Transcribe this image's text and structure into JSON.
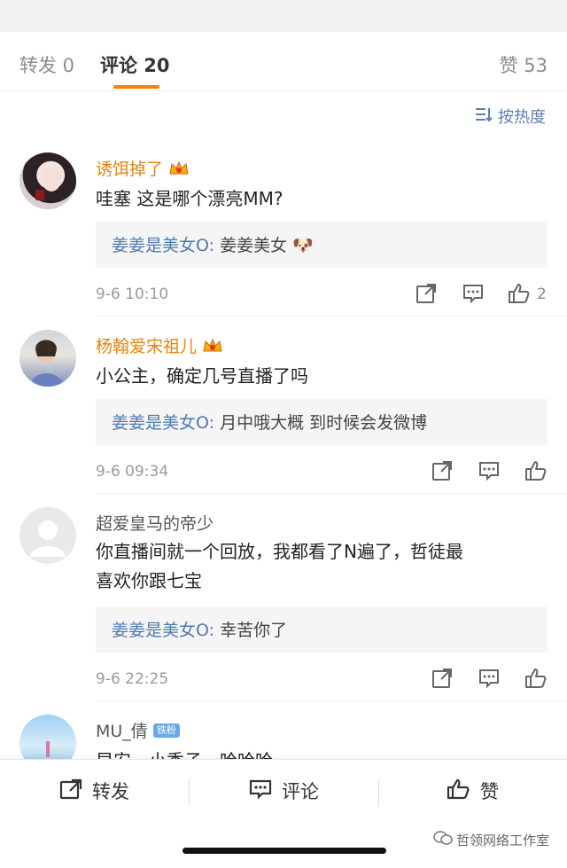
{
  "tabs": {
    "repost": "转发 0",
    "comments": "评论 20",
    "likes": "赞 53"
  },
  "sort": {
    "label": "按热度"
  },
  "comments": [
    {
      "username": "诱饵掉了",
      "text": "哇塞 这是哪个漂亮MM?",
      "reply_user": "姜姜是美女O:",
      "reply_text": " 姜姜美女",
      "reply_emoji": "🐶",
      "time": "9-6 10:10",
      "like_count": "2"
    },
    {
      "username": "杨翰爱宋祖儿",
      "text": "小公主，确定几号直播了吗",
      "reply_user": "姜姜是美女O:",
      "reply_text": " 月中哦大概 到时候会发微博",
      "time": "9-6 09:34"
    },
    {
      "username": "超爱皇马的帝少",
      "text_line1": "你直播间就一个回放，我都看了N遍了，哲徒最",
      "text_line2": "喜欢你跟七宝",
      "reply_user": "姜姜是美女O:",
      "reply_text": " 幸苦你了",
      "time": "9-6 22:25"
    },
    {
      "username": "MU_倩",
      "badge": "铁粉",
      "text": "早安，小秀子，哈哈哈"
    }
  ],
  "bottom": {
    "repost": "转发",
    "comment": "评论",
    "like": "赞"
  },
  "watermark": "哲领网络工作室",
  "colors": {
    "accent": "#ff8200",
    "username": "#e8830c",
    "reply_name": "#4e79b3",
    "reply_bg": "#f5f5f5"
  },
  "icons": [
    "sort-icon",
    "share-icon",
    "comment-icon",
    "like-icon",
    "crown-icon",
    "wechat-icon"
  ]
}
